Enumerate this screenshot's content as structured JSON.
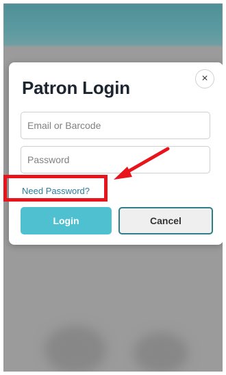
{
  "modal": {
    "title": "Patron Login",
    "close_icon": "×",
    "email_placeholder": "Email or Barcode",
    "password_placeholder": "Password",
    "need_password_link": "Need Password?",
    "login_button": "Login",
    "cancel_button": "Cancel"
  },
  "colors": {
    "header": "#5b9aa0",
    "login_button": "#4fc0d0",
    "cancel_border": "#2f7d86",
    "link": "#2b7d9c",
    "annotation": "#e8141c"
  },
  "icons": {
    "close": "close-icon",
    "annotation_arrow": "arrow-icon"
  }
}
